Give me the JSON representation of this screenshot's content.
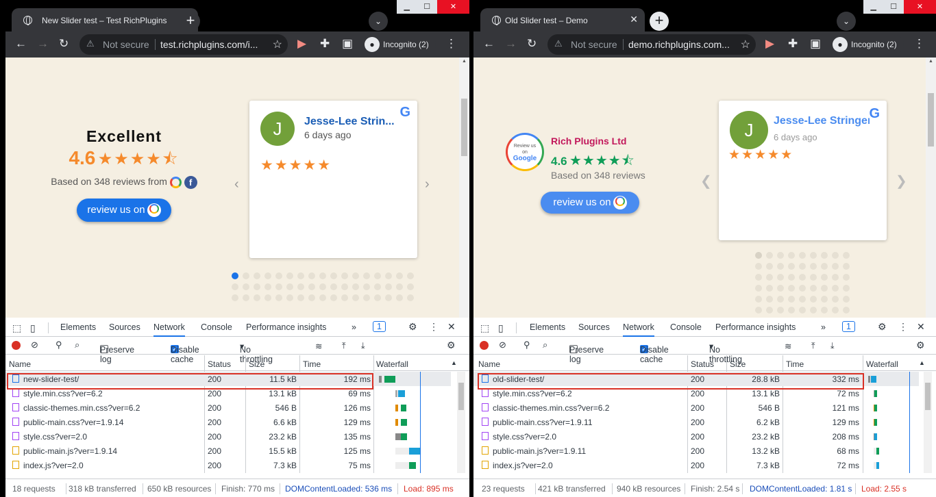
{
  "left": {
    "tab_title": "New Slider test – Test RichPlugins",
    "not_secure": "Not secure",
    "url": "test.richplugins.com/i...",
    "incognito": "Incognito (2)",
    "summary": {
      "heading": "Excellent",
      "rating": "4.6",
      "stars": "★★★★⯪",
      "based": "Based on 348 reviews from",
      "review_btn": "review us on"
    },
    "review": {
      "initial": "J",
      "name": "Jesse-Lee Strin...",
      "date": "6 days ago",
      "stars": "★★★★★"
    },
    "devtools": {
      "tabs": [
        "Elements",
        "Sources",
        "Network",
        "Console",
        "Performance insights",
        "»"
      ],
      "issues": "1",
      "preserve_log": "Preserve log",
      "disable_cache": "Disable cache",
      "throttling": "No throttling",
      "columns": [
        "Name",
        "Status",
        "Size",
        "Time",
        "Waterfall"
      ],
      "rows": [
        {
          "name": "new-slider-test/",
          "status": "200",
          "size": "11.5 kB",
          "time": "192 ms",
          "type": "doc"
        },
        {
          "name": "style.min.css?ver=6.2",
          "status": "200",
          "size": "13.1 kB",
          "time": "69 ms",
          "type": "css"
        },
        {
          "name": "classic-themes.min.css?ver=6.2",
          "status": "200",
          "size": "546 B",
          "time": "126 ms",
          "type": "css"
        },
        {
          "name": "public-main.css?ver=1.9.14",
          "status": "200",
          "size": "6.6 kB",
          "time": "129 ms",
          "type": "css"
        },
        {
          "name": "style.css?ver=2.0",
          "status": "200",
          "size": "23.2 kB",
          "time": "135 ms",
          "type": "css"
        },
        {
          "name": "public-main.js?ver=1.9.14",
          "status": "200",
          "size": "15.5 kB",
          "time": "125 ms",
          "type": "js"
        },
        {
          "name": "index.js?ver=2.0",
          "status": "200",
          "size": "7.3 kB",
          "time": "75 ms",
          "type": "js"
        }
      ],
      "footer": {
        "requests": "18 requests",
        "transferred": "318 kB transferred",
        "resources": "650 kB resources",
        "finish": "Finish: 770 ms",
        "dcl": "DOMContentLoaded: 536 ms",
        "load": "Load: 895 ms"
      }
    }
  },
  "right": {
    "tab_title": "Old Slider test – Demo",
    "not_secure": "Not secure",
    "url": "demo.richplugins.com...",
    "incognito": "Incognito (2)",
    "summary": {
      "badge_line1": "Review us",
      "badge_line2": "on",
      "badge_line3": "Google",
      "business": "Rich Plugins Ltd",
      "rating": "4.6",
      "stars": "★★★★⯪",
      "based": "Based on 348 reviews",
      "review_btn": "review us on"
    },
    "review": {
      "initial": "J",
      "name": "Jesse-Lee Stringer",
      "date": "6 days ago",
      "stars": "★★★★★"
    },
    "devtools": {
      "tabs": [
        "Elements",
        "Sources",
        "Network",
        "Console",
        "Performance insights",
        "»"
      ],
      "issues": "1",
      "preserve_log": "Preserve log",
      "disable_cache": "Disable cache",
      "throttling": "No throttling",
      "columns": [
        "Name",
        "Status",
        "Size",
        "Time",
        "Waterfall"
      ],
      "rows": [
        {
          "name": "old-slider-test/",
          "status": "200",
          "size": "28.8 kB",
          "time": "332 ms",
          "type": "doc"
        },
        {
          "name": "style.min.css?ver=6.2",
          "status": "200",
          "size": "13.1 kB",
          "time": "72 ms",
          "type": "css"
        },
        {
          "name": "classic-themes.min.css?ver=6.2",
          "status": "200",
          "size": "546 B",
          "time": "121 ms",
          "type": "css"
        },
        {
          "name": "public-main.css?ver=1.9.11",
          "status": "200",
          "size": "6.2 kB",
          "time": "129 ms",
          "type": "css"
        },
        {
          "name": "style.css?ver=2.0",
          "status": "200",
          "size": "23.2 kB",
          "time": "208 ms",
          "type": "css"
        },
        {
          "name": "public-main.js?ver=1.9.11",
          "status": "200",
          "size": "13.2 kB",
          "time": "68 ms",
          "type": "js"
        },
        {
          "name": "index.js?ver=2.0",
          "status": "200",
          "size": "7.3 kB",
          "time": "72 ms",
          "type": "js"
        }
      ],
      "footer": {
        "requests": "23 requests",
        "transferred": "421 kB transferred",
        "resources": "940 kB resources",
        "finish": "Finish: 2.54 s",
        "dcl": "DOMContentLoaded: 1.81 s",
        "load": "Load: 2.55 s"
      }
    }
  },
  "colors": {
    "accent": "#1a73e8",
    "star": "#f58a2c",
    "highlight": "#d93025",
    "page_bg": "#f5efe2"
  },
  "icons": [
    "back-icon",
    "forward-icon",
    "reload-icon",
    "warning-icon",
    "star-icon",
    "extension-icon",
    "sidepanel-icon",
    "incognito-icon",
    "menu-icon",
    "google-icon",
    "facebook-icon",
    "inspect-icon",
    "device-icon",
    "settings-icon",
    "close-icon",
    "record-icon",
    "clear-icon",
    "filter-icon",
    "search-icon",
    "wifi-icon",
    "upload-icon",
    "download-icon"
  ]
}
